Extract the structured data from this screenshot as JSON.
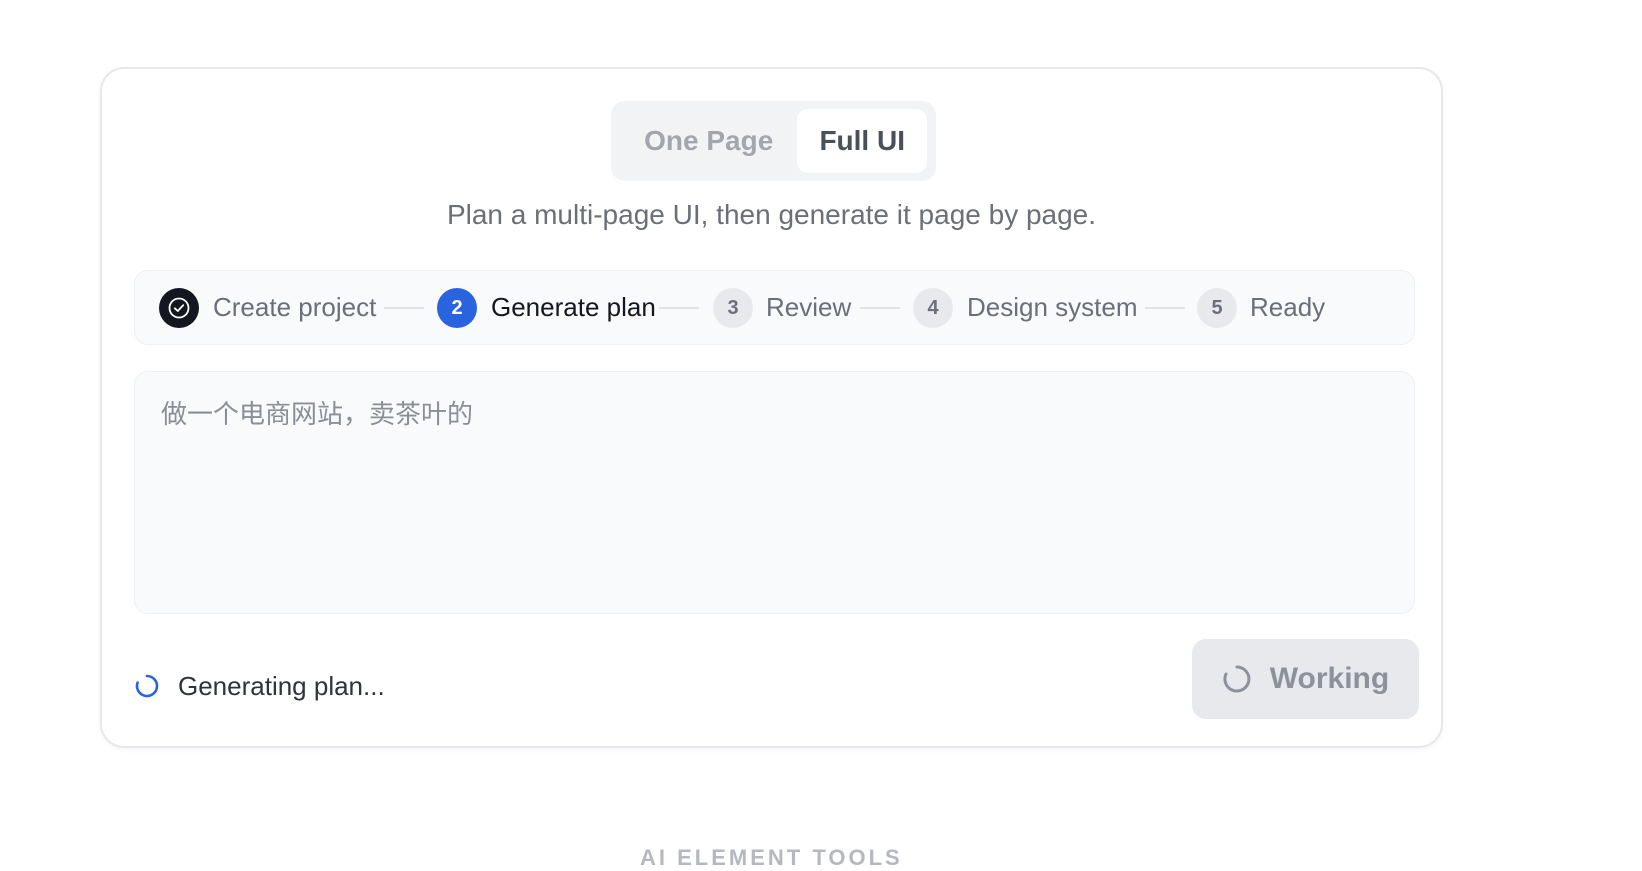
{
  "mode_toggle": {
    "options": [
      {
        "label": "One Page",
        "active": false
      },
      {
        "label": "Full UI",
        "active": true
      }
    ]
  },
  "subtitle": "Plan a multi-page UI, then generate it page by page.",
  "stepper": {
    "steps": [
      {
        "number": "",
        "label": "Create project",
        "state": "done",
        "icon": "check-circle-icon"
      },
      {
        "number": "2",
        "label": "Generate plan",
        "state": "current"
      },
      {
        "number": "3",
        "label": "Review",
        "state": "pending"
      },
      {
        "number": "4",
        "label": "Design system",
        "state": "pending"
      },
      {
        "number": "5",
        "label": "Ready",
        "state": "pending"
      }
    ]
  },
  "prompt": {
    "value": "做一个电商网站，卖茶叶的"
  },
  "status": {
    "text": "Generating plan...",
    "icon": "spinner-icon",
    "color": "#2a63df"
  },
  "action_button": {
    "label": "Working",
    "icon": "spinner-icon",
    "disabled": true
  },
  "section_heading": "AI ELEMENT TOOLS",
  "colors": {
    "accent": "#2a63df",
    "done": "#14171f",
    "pending": "#e8e9ec"
  }
}
